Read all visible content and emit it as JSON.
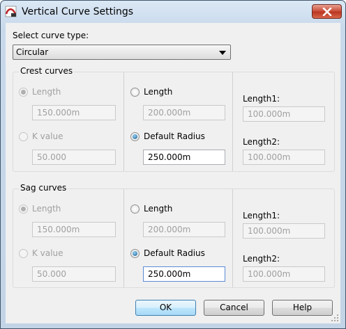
{
  "window": {
    "title": "Vertical Curve Settings"
  },
  "curve_type": {
    "label": "Select curve type:",
    "selected": "Circular"
  },
  "crest": {
    "title": "Crest curves",
    "length_radio": "Length",
    "length_value": "150.000m",
    "k_radio": "K value",
    "k_value": "50.000",
    "col2_length_radio": "Length",
    "col2_length_value": "200.000m",
    "default_radius_radio": "Default Radius",
    "default_radius_value": "250.000m",
    "length1_label": "Length1:",
    "length1_value": "100.000m",
    "length2_label": "Length2:",
    "length2_value": "100.000m"
  },
  "sag": {
    "title": "Sag curves",
    "length_radio": "Length",
    "length_value": "150.000m",
    "k_radio": "K value",
    "k_value": "50.000",
    "col2_length_radio": "Length",
    "col2_length_value": "200.000m",
    "default_radius_radio": "Default Radius",
    "default_radius_value": "250.000m",
    "length1_label": "Length1:",
    "length1_value": "100.000m",
    "length2_label": "Length2:",
    "length2_value": "100.000m"
  },
  "buttons": {
    "ok": "OK",
    "cancel": "Cancel",
    "help": "Help"
  },
  "icons": {
    "app": "app-icon",
    "close": "close-icon",
    "dropdown": "chevron-down-icon",
    "grip": "resize-grip-icon"
  },
  "colors": {
    "title_bar": "#c8d9eb",
    "close_button": "#c84a35",
    "default_button_border": "#3c7fb1",
    "radio_selected": "#1c5b8d"
  }
}
